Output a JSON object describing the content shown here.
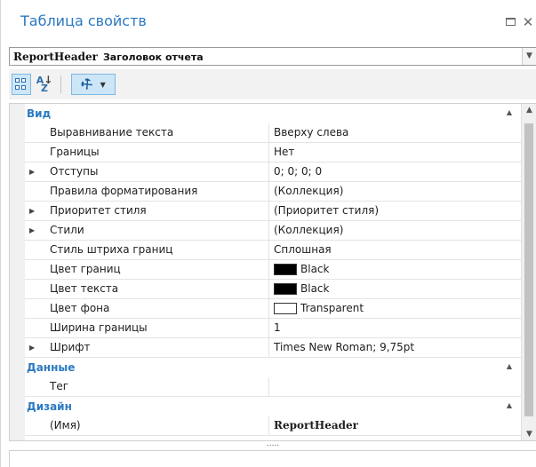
{
  "window": {
    "title": "Таблица свойств",
    "minimize_icon": "window-restore-icon",
    "close_symbol": "✕"
  },
  "object_selector": {
    "name": "ReportHeader",
    "type": "Заголовок отчета"
  },
  "toolbar": {
    "buttons": [
      {
        "name": "categorized-view-button",
        "icon": "categorized-icon",
        "active": true
      },
      {
        "name": "alphabetical-view-button",
        "icon": "sort-az-icon",
        "active": false
      },
      {
        "name": "settings-dropdown-button",
        "icon": "wrench-icon",
        "active": true
      }
    ]
  },
  "grid": {
    "categories": [
      {
        "label": "Вид",
        "expanded": true,
        "rows": [
          {
            "name": "Выравнивание текста",
            "value": "Вверху слева",
            "expandable": false
          },
          {
            "name": "Границы",
            "value": "Нет",
            "expandable": false
          },
          {
            "name": "Отступы",
            "value": "0; 0; 0; 0",
            "expandable": true
          },
          {
            "name": "Правила форматирования",
            "value": "(Коллекция)",
            "expandable": false
          },
          {
            "name": "Приоритет стиля",
            "value": "(Приоритет стиля)",
            "expandable": true
          },
          {
            "name": "Стили",
            "value": "(Коллекция)",
            "expandable": true
          },
          {
            "name": "Стиль штриха границ",
            "value": "Сплошная",
            "expandable": false
          },
          {
            "name": "Цвет границ",
            "value": "Black",
            "swatch": "#000000",
            "expandable": false
          },
          {
            "name": "Цвет текста",
            "value": "Black",
            "swatch": "#000000",
            "expandable": false
          },
          {
            "name": "Цвет фона",
            "value": "Transparent",
            "swatch": "#ffffff",
            "expandable": false
          },
          {
            "name": "Ширина границы",
            "value": "1",
            "expandable": false
          },
          {
            "name": "Шрифт",
            "value": "Times New Roman; 9,75pt",
            "expandable": true
          }
        ]
      },
      {
        "label": "Данные",
        "expanded": true,
        "rows": [
          {
            "name": "Тег",
            "value": "",
            "expandable": false
          }
        ]
      },
      {
        "label": "Дизайн",
        "expanded": true,
        "rows": [
          {
            "name": "(Имя)",
            "value": "ReportHeader",
            "bold": true,
            "expandable": false
          }
        ]
      }
    ]
  },
  "splitter": {
    "label": "....."
  },
  "colors": {
    "accent": "#2b79c2",
    "toolbar_bg": "#f2f2f2",
    "active_button_bg": "#cde6f7",
    "gutter": "#f0f0f0"
  }
}
